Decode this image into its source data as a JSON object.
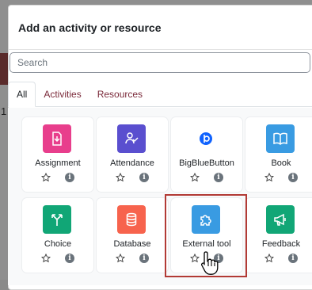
{
  "backdrop": {
    "fragment_text": "1"
  },
  "modal": {
    "title": "Add an activity or resource",
    "search_placeholder": "Search"
  },
  "tabs": [
    {
      "label": "All",
      "active": true
    },
    {
      "label": "Activities",
      "active": false
    },
    {
      "label": "Resources",
      "active": false
    }
  ],
  "items": [
    {
      "label": "Assignment",
      "icon": "assignment-icon",
      "color": "#e83e8c"
    },
    {
      "label": "Attendance",
      "icon": "attendance-icon",
      "color": "#5a4fcf"
    },
    {
      "label": "BigBlueButton",
      "icon": "bigbluebutton-icon",
      "color": "#0f62fe"
    },
    {
      "label": "Book",
      "icon": "book-icon",
      "color": "#399be2"
    },
    {
      "label": "Choice",
      "icon": "choice-icon",
      "color": "#11a676"
    },
    {
      "label": "Database",
      "icon": "database-icon",
      "color": "#f7634d"
    },
    {
      "label": "External tool",
      "icon": "puzzle-icon",
      "color": "#399be2"
    },
    {
      "label": "Feedback",
      "icon": "megaphone-icon",
      "color": "#11a676"
    }
  ],
  "colors": {
    "accent": "#7b2a3a",
    "highlight": "#b23a35"
  }
}
